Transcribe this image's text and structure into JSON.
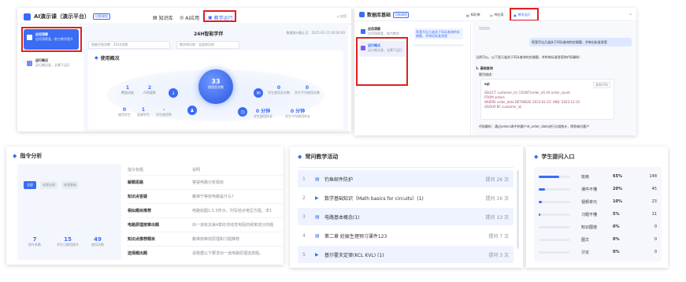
{
  "panel1": {
    "title": "AI演示课（演示平台）",
    "badge": "切换课程",
    "nav": [
      {
        "label": "知识库",
        "icon": "book-icon"
      },
      {
        "label": "AI应用",
        "icon": "robot-icon"
      },
      {
        "label": "教学运行",
        "icon": "monitor-icon"
      }
    ],
    "app_label": "应用",
    "sidebar": [
      {
        "title": "应用洞察",
        "sub": "应用洞察类，助力教学提升"
      },
      {
        "title": "运行概况",
        "sub": "运行概况类，全景下运行"
      }
    ],
    "header": {
      "title": "24H智能学伴",
      "date": "数据统计截止至：2025-01-11 00:00:00"
    },
    "filter": {
      "label": "智能问答学期",
      "value": "2024学期",
      "label2": "教学知识库",
      "placeholder": "全部知识库"
    },
    "section_title": "使用概况",
    "center": {
      "value": "33",
      "label": "使用总次数"
    },
    "left_stats_top": [
      {
        "value": "1",
        "label": "覆盖班级"
      },
      {
        "value": "2",
        "label": "AI答疑数"
      }
    ],
    "left_stats_bottom": [
      {
        "value": "0",
        "label": "使用学生"
      },
      {
        "value": "1",
        "label": "选课学生"
      },
      {
        "value": "-",
        "label": "学生使用率"
      }
    ],
    "right_stats_top": [
      {
        "value": "0",
        "label": "学生使用总次数"
      },
      {
        "value": "0",
        "label": "学生平均使用次数"
      }
    ],
    "right_stats_bottom": [
      {
        "value": "0 分钟",
        "label": "学生使用时长"
      },
      {
        "value": "0 分钟",
        "label": "学生平均使用时长"
      }
    ]
  },
  "panel2": {
    "title": "数据库基础",
    "badge": "切换课程",
    "nav": [
      {
        "label": "知识库",
        "icon": "book-icon"
      },
      {
        "label": "AI应用",
        "icon": "robot-icon"
      },
      {
        "label": "教学运行",
        "icon": "monitor-icon"
      }
    ],
    "sidebar": [
      {
        "title": "应用洞察",
        "sub": "应用洞察类，助力教学"
      },
      {
        "title": "运行概况",
        "sub": "运行概况类，全景下运行"
      }
    ],
    "user_msg": "帮我写出几道关于SQL查询的实操题，并带出标准答案",
    "bot_intro": "当然可以，以下是几道关于SQL查询的实操题，并附有标准答案和代码解析：",
    "q1_title": "1. 基础查询",
    "q1_sub": "题目描述：",
    "code_lang": "sql",
    "code_btn": "复制代码",
    "code_lines": [
      "SELECT customer_id, COUNT(order_id) AS order_count",
      "FROM orders",
      "WHERE order_date BETWEEN '2023-01-01' AND '2023-12-31'",
      "GROUP BY customer_id;"
    ],
    "analysis": "代码解析：通过orders表中的客户id_order_date进行分组统计，得到每位客户"
  },
  "panel3": {
    "title": "指令分析",
    "tabs": [
      "全部",
      "电源法规",
      "电源基础"
    ],
    "stats": [
      {
        "value": "7",
        "label": "指令条数"
      },
      {
        "value": "15",
        "label": "学生已使用指令"
      },
      {
        "value": "49",
        "label": "使用次数"
      }
    ],
    "col_headers": [
      "指令标题",
      "说明"
    ],
    "rows": [
      {
        "title": "解题思路",
        "desc": "答疑电路分析题目"
      },
      {
        "title": "知识点答疑",
        "desc": "戴维宁等效电路是什么?"
      },
      {
        "title": "相似题目推荐",
        "desc": "电路如图1.5.5所示，列写结点电压方程，求1"
      },
      {
        "title": "电路原理按章出题",
        "desc": "出一道有关第4章的非线性电阻的频率成分的题"
      },
      {
        "title": "知识点推荐题目",
        "desc": "戴维南等效原理和习题推荐"
      },
      {
        "title": "选择题出题",
        "desc": "请根据以下要求出一道电路原理选择题。"
      }
    ]
  },
  "panel4": {
    "title": "常问教学活动",
    "items": [
      {
        "idx": "1",
        "icon": "doc-icon",
        "name": "钓鱼邮件防护",
        "count": "提问 26 次"
      },
      {
        "idx": "2",
        "icon": "play-icon",
        "name": "数学基础知识（Math basics for circuits）(1)",
        "count": "提问 16 次"
      },
      {
        "idx": "3",
        "icon": "doc-icon",
        "name": "电路基本概念(1)",
        "count": "提问 13 次"
      },
      {
        "idx": "4",
        "icon": "doc-icon",
        "name": "第二章 妊娠生理预习课件123",
        "count": "提问 7 次"
      },
      {
        "idx": "5",
        "icon": "play-icon",
        "name": "基尔霍夫定律(KCL KVL) (1)",
        "count": "提问 3 次"
      }
    ]
  },
  "panel5": {
    "title": "学生提问入口",
    "rows": [
      {
        "name": "班级",
        "pct": "65%",
        "count": "148",
        "fill": 0.65
      },
      {
        "name": "课件不懂",
        "pct": "20%",
        "count": "45",
        "fill": 0.2
      },
      {
        "name": "视频单元",
        "pct": "10%",
        "count": "23",
        "fill": 0.1
      },
      {
        "name": "习题不懂",
        "pct": "5%",
        "count": "11",
        "fill": 0.05
      },
      {
        "name": "知识图谱",
        "pct": "0%",
        "count": "0",
        "fill": 0
      },
      {
        "name": "图文",
        "pct": "0%",
        "count": "0",
        "fill": 0
      },
      {
        "name": "讨论",
        "pct": "0%",
        "count": "0",
        "fill": 0
      }
    ]
  },
  "colors": {
    "accent": "#3a6cf4",
    "highlight": "#e02020",
    "light_blue": "#eef3ff"
  }
}
